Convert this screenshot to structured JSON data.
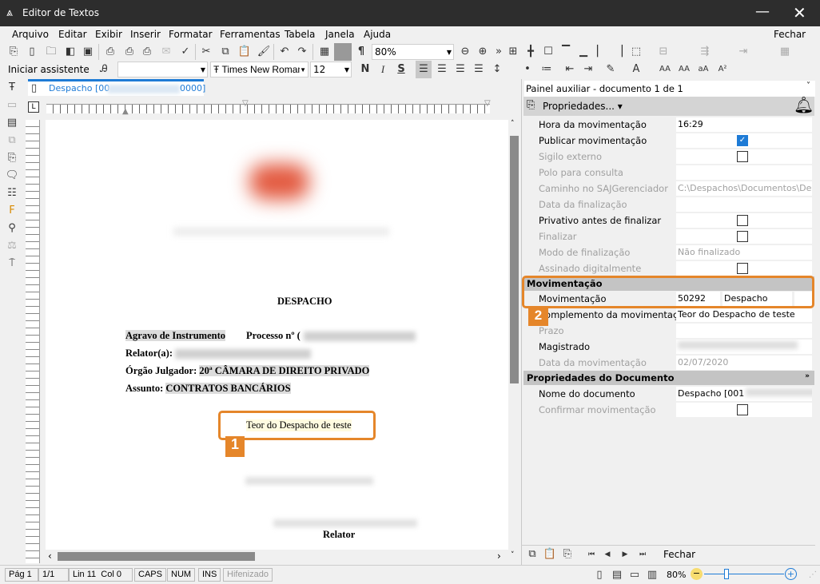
{
  "window": {
    "title": "Editor de Textos",
    "minimize": "—",
    "close": "✕"
  },
  "menu": {
    "items": [
      "Arquivo",
      "Editar",
      "Exibir",
      "Inserir",
      "Formatar",
      "Ferramentas",
      "Tabela",
      "Janela",
      "Ajuda"
    ],
    "close_label": "Fechar"
  },
  "toolbar": {
    "zoom": "80%",
    "assistant": "Iniciar assistente",
    "style_value": "",
    "font": "Times New Roman",
    "font_size": "12",
    "bold": "N",
    "italic": "I",
    "underline": "S"
  },
  "doc_tab": {
    "label_start": "Despacho [00",
    "label_end": "0000]"
  },
  "document": {
    "title": "DESPACHO",
    "line1_label": "Agravo de Instrumento",
    "line1_proc": "Processo nº (",
    "relator_label": "Relator(a):",
    "orgao_label": "Órgão Julgador:",
    "orgao_value": "20ª CÂMARA DE DIREITO PRIVADO",
    "assunto_label": "Assunto:",
    "assunto_value": "CONTRATOS BANCÁRIOS",
    "teor": "Teor do Despacho de teste",
    "signature": "Relator"
  },
  "panel": {
    "title": "Painel auxiliar - documento 1 de 1",
    "properties_button": "Propriedades...",
    "rows": [
      {
        "label": "Hora da movimentação",
        "value": "16:29",
        "enabled": true
      },
      {
        "label": "Publicar movimentação",
        "checked": true,
        "enabled": true
      },
      {
        "label": "Sigilo externo",
        "checked": false,
        "enabled": false
      },
      {
        "label": "Polo para consulta",
        "value": "",
        "enabled": false
      },
      {
        "label": "Caminho no SAJGerenciador",
        "value": "C:\\Despachos\\Documentos\\De...",
        "enabled": false
      },
      {
        "label": "Data da finalização",
        "value": "",
        "enabled": false
      },
      {
        "label": "Privativo antes de finalizar",
        "checked": false,
        "enabled": true
      },
      {
        "label": "Finalizar",
        "checked": false,
        "enabled": false
      },
      {
        "label": "Modo de finalização",
        "value": "Não finalizado",
        "enabled": false
      },
      {
        "label": "Assinado digitalmente",
        "checked": false,
        "enabled": false
      }
    ],
    "section_mov": "Movimentação",
    "mov_rows": [
      {
        "label": "Movimentação",
        "code": "50292",
        "value": "Despacho"
      },
      {
        "label": "Complemento da movimentação",
        "value": "Teor do Despacho de teste"
      },
      {
        "label": "Prazo",
        "value": ""
      },
      {
        "label": "Magistrado",
        "value": ""
      },
      {
        "label": "Data da movimentação",
        "value": "02/07/2020"
      }
    ],
    "section_doc": "Propriedades do Documento",
    "doc_rows": [
      {
        "label": "Nome do documento",
        "value": "Despacho [001"
      },
      {
        "label": "Confirmar movimentação",
        "checked": false
      }
    ],
    "footer_close": "Fechar"
  },
  "status": {
    "page": "Pág 1",
    "pages": "1/1",
    "position": "Lin 11  Col 0",
    "caps": "CAPS",
    "num": "NUM",
    "ins": "INS",
    "hyphen": "Hifenizado",
    "zoom": "80%",
    "zoom_level": 0.5
  },
  "annotations": {
    "one": "1",
    "two": "2",
    "color": "#e5862a"
  }
}
